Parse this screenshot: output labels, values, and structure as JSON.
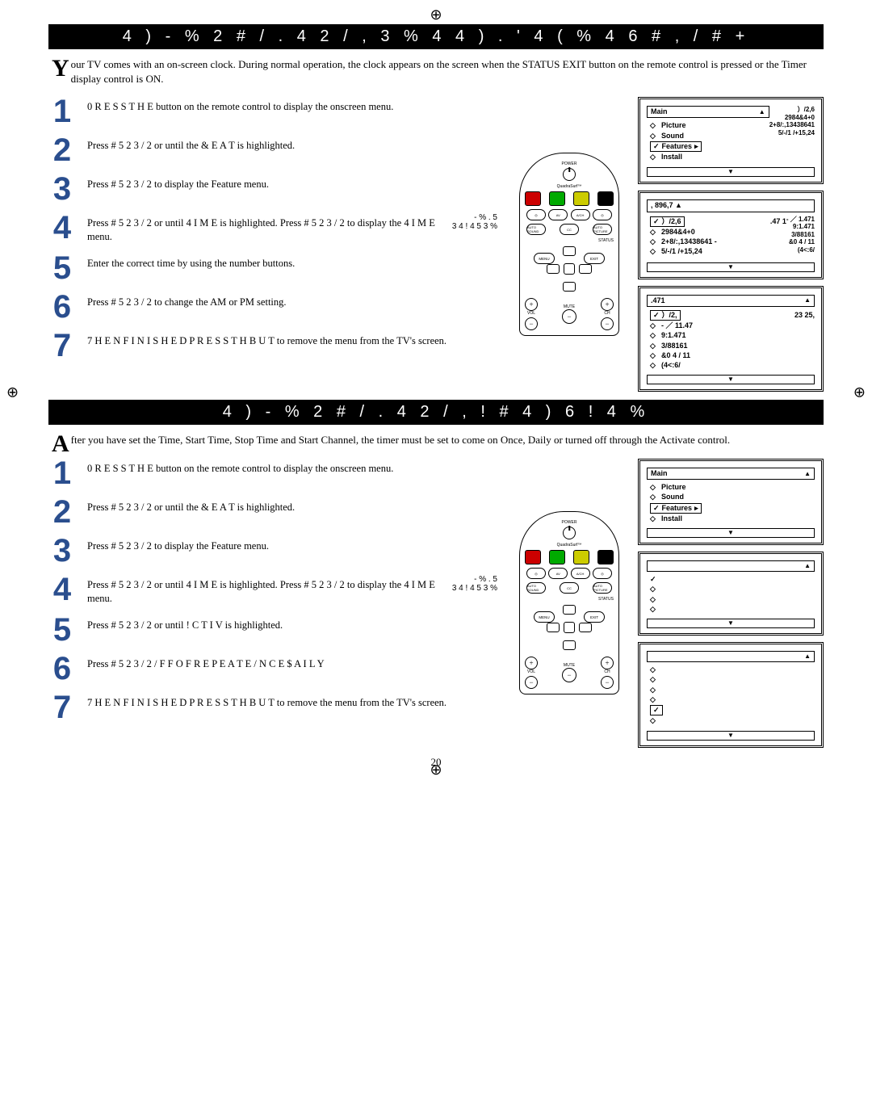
{
  "registration_mark": "⊕",
  "section1": {
    "banner": "4 ) - % 2   # / . 4 2 / ,     3 % 4 4 ) . '   4 ( %   4 6   # , / # +",
    "intro_first_letter": "Y",
    "intro_rest": "our TV comes with an on-screen clock.  During normal operation, the clock appears on the screen when the STATUS EXIT button on the remote control is pressed or the Timer display control is ON."
  },
  "section2": {
    "banner": "4 ) - % 2   # / . 4 2 / ,     ! # 4 ) 6 ! 4 %",
    "intro_first_letter": "A",
    "intro_rest": "fter you have set the Time, Start Time, Stop Time and Start Channel, the timer must be set to come on Once, Daily or turned off through the Activate control."
  },
  "steps_a": {
    "1": " 0 R E S S   T H E button on the remote control to display the onscreen menu.",
    "2": "Press  # 5 2 3 / 2      or      until the  & E A T     is highlighted.",
    "3": "Press  # 5 2 3 / 2    to display the Feature menu.",
    "4": "Press  # 5 2 3 / 2      or      until  4 I M E is highlighted.  Press  # 5 2 3 / 2    to display the  4 I M E menu.",
    "5": "Enter the correct time by using the number buttons.",
    "6": "Press  # 5 2 3 / 2    to change the AM or PM setting.",
    "7": " 7 H E N   F I N I S H E D     P R E S S   T H     B U T  to remove the menu from the TV's screen."
  },
  "steps_b": {
    "1": " 0 R E S S   T H E button on the remote control to display the onscreen menu.",
    "2": "Press  # 5 2 3 / 2      or      until the  & E A T     is highlighted.",
    "3": "Press  # 5 2 3 / 2    to display the Feature menu.",
    "4": "Press  # 5 2 3 / 2      or      until  4 I M E is highlighted.  Press  # 5 2 3 / 2    to display the  4 I M E menu.",
    "5": "Press  # 5 2 3 / 2      or      until  ! C T I V  is highlighted.",
    "6": "Press  # 5 2 3 / 2     / F F    O F    R E P E A T E    / N C E   $ A I L Y",
    "7": " 7 H E N   F I N I S H E D     P R E S S   T H     B U T  to remove the menu from the TV's screen."
  },
  "menu_exit_label_line1": " - % . 5",
  "menu_exit_label_line2": "3 4 ! 4 5 3     %",
  "remote": {
    "power_lbl": "POWER",
    "qs_lbl": "QuadraSurf™",
    "av": "AV",
    "ach": "A/CH",
    "auto_sound": "AUTO SOUND",
    "cc": "CC",
    "auto_pic": "AUTO PICTURE",
    "status_lbl": "STATUS",
    "menu": "MENU",
    "exit": "EXIT",
    "vol": "VOL",
    "ch": "CH",
    "mute": "MUTE"
  },
  "osd1": {
    "title": "Main",
    "items": [
      "Picture",
      "Sound",
      "Features",
      "Install"
    ],
    "right": [
      "）/2,6",
      "2984&4+0",
      "2+8/:,13438641",
      "5/-/1  /+15,24"
    ]
  },
  "osd2": {
    "title": ", 896,7  ▲",
    "sel": "）/2,6",
    "sel_right": ".47 1",
    "items": [
      "2984&4+0",
      "2+8/:,13438641 -",
      "5/-/1  /+15,24"
    ],
    "right": [
      "- ／  1.471",
      "9:1.471",
      "3/88161",
      "&0  4  /  11",
      "(4<:6/"
    ]
  },
  "osd3": {
    "title": ".471",
    "sel": "）/2,",
    "sel_right": "23  25,",
    "items": [
      "- ／    11.47",
      "9:1.471",
      "3/88161",
      "&0  4  /  11",
      "(4<:6/"
    ]
  },
  "osd_b1": {
    "title": "Main",
    "items": [
      "Picture",
      "Sound",
      "Features",
      "Install"
    ]
  },
  "page_number": "20"
}
